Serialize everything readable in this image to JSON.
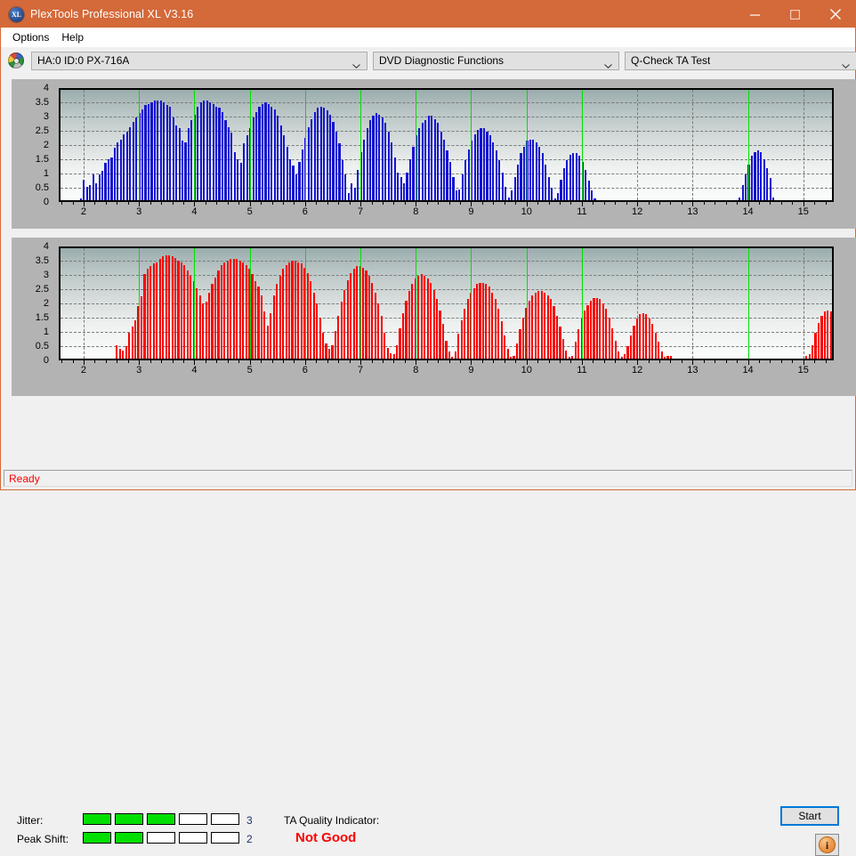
{
  "window": {
    "title": "PlexTools Professional XL V3.16",
    "app_icon": "XL",
    "minimize": "minimize-icon",
    "maximize": "maximize-icon",
    "close": "close-icon",
    "accent_color": "#d4693a"
  },
  "menu": {
    "items": [
      "Options",
      "Help"
    ]
  },
  "toolbar": {
    "drive_combo": {
      "value": "HA:0 ID:0  PX-716A",
      "icon": "disc-icon"
    },
    "function_combo": {
      "value": "DVD Diagnostic Functions"
    },
    "test_combo": {
      "value": "Q-Check TA Test"
    }
  },
  "indicators": {
    "jitter_label": "Jitter:",
    "jitter_value": "3",
    "jitter_segments": 5,
    "jitter_filled": 3,
    "peak_shift_label": "Peak Shift:",
    "peak_shift_value": "2",
    "peak_shift_segments": 5,
    "peak_shift_filled": 2,
    "meter_on_color": "#00e000",
    "ta_label": "TA Quality Indicator:",
    "ta_value": "Not Good",
    "ta_value_color": "#ff0000"
  },
  "actions": {
    "start_label": "Start",
    "info_label": "i",
    "info_name": "info-icon"
  },
  "statusbar": {
    "text": "Ready",
    "color": "#ff0000"
  },
  "chart_data": [
    {
      "id": "ta-test-chart-upper",
      "type": "bar",
      "title": "",
      "xlabel": "",
      "ylabel": "",
      "series_color": "#1414d2",
      "marker_color": "#00e000",
      "grid": true,
      "xlim": [
        1.55,
        15.55
      ],
      "ylim": [
        0,
        4
      ],
      "yticks": [
        0,
        0.5,
        1,
        1.5,
        2,
        2.5,
        3,
        3.5,
        4
      ],
      "ytick_labels": [
        "0",
        "0.5",
        "1",
        "1.5",
        "2",
        "2.5",
        "3",
        "3.5",
        "4"
      ],
      "xticks": [
        2,
        3,
        4,
        5,
        6,
        7,
        8,
        9,
        10,
        11,
        12,
        13,
        14,
        15
      ],
      "xtick_labels": [
        "2",
        "3",
        "4",
        "5",
        "6",
        "7",
        "8",
        "9",
        "10",
        "11",
        "12",
        "13",
        "14",
        "15"
      ],
      "markers_x": [
        3,
        4,
        5,
        6,
        7,
        8,
        9,
        10,
        11,
        14
      ],
      "bar_step": 0.0556,
      "x_start": 1.95,
      "values": [
        0.05,
        0.75,
        0.5,
        0.55,
        0.95,
        0.6,
        0.95,
        1.05,
        1.35,
        1.5,
        1.55,
        1.9,
        2.1,
        2.2,
        2.4,
        2.5,
        2.65,
        2.85,
        3.0,
        3.15,
        3.3,
        3.45,
        3.5,
        3.55,
        3.6,
        3.6,
        3.6,
        3.55,
        3.45,
        3.4,
        3.0,
        2.7,
        2.6,
        2.15,
        2.1,
        2.6,
        2.9,
        3.1,
        3.4,
        3.55,
        3.6,
        3.6,
        3.55,
        3.5,
        3.4,
        3.35,
        3.2,
        2.9,
        2.65,
        2.45,
        1.75,
        1.5,
        1.35,
        2.05,
        2.35,
        2.6,
        3.0,
        3.2,
        3.4,
        3.5,
        3.55,
        3.5,
        3.4,
        3.3,
        3.05,
        2.7,
        2.35,
        1.95,
        1.5,
        1.25,
        0.95,
        1.4,
        1.85,
        2.25,
        2.65,
        2.95,
        3.2,
        3.35,
        3.4,
        3.35,
        3.25,
        3.1,
        2.85,
        2.5,
        2.05,
        1.45,
        0.95,
        0.25,
        0.6,
        0.45,
        1.1,
        1.75,
        2.2,
        2.6,
        2.9,
        3.05,
        3.15,
        3.1,
        3.0,
        2.8,
        2.5,
        2.1,
        1.55,
        1.0,
        0.85,
        0.6,
        1.0,
        1.5,
        1.95,
        2.35,
        2.6,
        2.8,
        2.9,
        3.05,
        3.05,
        2.95,
        2.8,
        2.5,
        2.2,
        1.8,
        1.4,
        0.85,
        0.35,
        0.4,
        0.95,
        1.45,
        1.85,
        2.15,
        2.4,
        2.55,
        2.6,
        2.6,
        2.5,
        2.35,
        2.1,
        1.8,
        1.45,
        1.0,
        0.5,
        0.1,
        0.35,
        0.85,
        1.3,
        1.7,
        1.95,
        2.15,
        2.2,
        2.2,
        2.1,
        1.95,
        1.7,
        1.3,
        0.85,
        0.45,
        0.05,
        0.25,
        0.75,
        1.15,
        1.45,
        1.65,
        1.7,
        1.7,
        1.6,
        1.4,
        1.1,
        0.7,
        0.35,
        0.05,
        0,
        0,
        0,
        0,
        0,
        0,
        0,
        0,
        0,
        0,
        0,
        0,
        0,
        0,
        0,
        0,
        0,
        0,
        0,
        0,
        0,
        0,
        0,
        0,
        0,
        0,
        0,
        0,
        0,
        0,
        0,
        0,
        0,
        0,
        0,
        0,
        0,
        0,
        0,
        0,
        0,
        0,
        0,
        0,
        0,
        0,
        0.1,
        0.55,
        0.95,
        1.3,
        1.6,
        1.75,
        1.8,
        1.75,
        1.5,
        1.15,
        0.8,
        0.1,
        0,
        0,
        0,
        0,
        0,
        0,
        0,
        0,
        0,
        0,
        0,
        0,
        0,
        0,
        0,
        0,
        0,
        0,
        0
      ]
    },
    {
      "id": "ta-test-chart-lower",
      "type": "bar",
      "title": "",
      "xlabel": "",
      "ylabel": "",
      "series_color": "#fa0000",
      "marker_color": "#00e000",
      "grid": true,
      "xlim": [
        1.55,
        15.55
      ],
      "ylim": [
        0,
        4
      ],
      "yticks": [
        0,
        0.5,
        1,
        1.5,
        2,
        2.5,
        3,
        3.5,
        4
      ],
      "ytick_labels": [
        "0",
        "0.5",
        "1",
        "1.5",
        "2",
        "2.5",
        "3",
        "3.5",
        "4"
      ],
      "xticks": [
        2,
        3,
        4,
        5,
        6,
        7,
        8,
        9,
        10,
        11,
        12,
        13,
        14,
        15
      ],
      "xtick_labels": [
        "2",
        "3",
        "4",
        "5",
        "6",
        "7",
        "8",
        "9",
        "10",
        "11",
        "12",
        "13",
        "14",
        "15"
      ],
      "markers_x": [
        3,
        4,
        5,
        6,
        7,
        8,
        9,
        10,
        11,
        14
      ],
      "bar_step": 0.0556,
      "x_start": 2.6,
      "values": [
        0.5,
        0.35,
        0.3,
        0.45,
        0.95,
        1.15,
        1.4,
        1.9,
        2.25,
        3.05,
        3.25,
        3.35,
        3.45,
        3.5,
        3.6,
        3.7,
        3.75,
        3.75,
        3.7,
        3.65,
        3.55,
        3.5,
        3.4,
        3.2,
        3.0,
        2.8,
        2.55,
        2.3,
        2.0,
        2.05,
        2.4,
        2.7,
        2.95,
        3.2,
        3.4,
        3.5,
        3.55,
        3.6,
        3.6,
        3.6,
        3.55,
        3.5,
        3.4,
        3.25,
        3.05,
        2.8,
        2.6,
        2.3,
        1.7,
        1.2,
        1.65,
        2.3,
        2.7,
        3.0,
        3.25,
        3.4,
        3.5,
        3.55,
        3.55,
        3.5,
        3.45,
        3.3,
        3.1,
        2.8,
        2.4,
        2.0,
        1.5,
        0.95,
        0.55,
        0.35,
        0.5,
        1.0,
        1.55,
        2.05,
        2.5,
        2.85,
        3.1,
        3.25,
        3.35,
        3.35,
        3.3,
        3.2,
        3.0,
        2.75,
        2.4,
        2.0,
        1.55,
        0.95,
        0.4,
        0.2,
        0.15,
        0.5,
        1.1,
        1.65,
        2.1,
        2.45,
        2.7,
        2.9,
        3.0,
        3.05,
        3.0,
        2.9,
        2.75,
        2.5,
        2.15,
        1.75,
        1.25,
        0.65,
        0.25,
        0.05,
        0.25,
        0.9,
        1.4,
        1.8,
        2.15,
        2.4,
        2.55,
        2.7,
        2.75,
        2.75,
        2.7,
        2.6,
        2.4,
        2.15,
        1.8,
        1.35,
        0.85,
        0.35,
        0.05,
        0.1,
        0.55,
        1.05,
        1.5,
        1.85,
        2.1,
        2.3,
        2.4,
        2.45,
        2.45,
        2.4,
        2.3,
        2.15,
        1.9,
        1.55,
        1.15,
        0.7,
        0.3,
        0.05,
        0.1,
        0.6,
        1.05,
        1.45,
        1.75,
        1.95,
        2.1,
        2.2,
        2.2,
        2.15,
        2.0,
        1.8,
        1.5,
        1.1,
        0.65,
        0.25,
        0.05,
        0.15,
        0.45,
        0.85,
        1.2,
        1.45,
        1.6,
        1.65,
        1.6,
        1.45,
        1.25,
        0.95,
        0.6,
        0.25,
        0.05,
        0.1,
        0.1,
        0,
        0,
        0,
        0,
        0,
        0,
        0,
        0,
        0,
        0,
        0,
        0,
        0,
        0,
        0,
        0,
        0,
        0,
        0,
        0,
        0,
        0,
        0,
        0,
        0,
        0,
        0,
        0,
        0,
        0,
        0,
        0,
        0,
        0,
        0,
        0,
        0,
        0,
        0,
        0,
        0,
        0,
        0,
        0.1,
        0.15,
        0.5,
        0.95,
        1.3,
        1.55,
        1.7,
        1.75,
        1.7,
        1.55,
        1.25,
        0.9,
        0.45,
        0.1,
        0,
        0,
        0,
        0,
        0,
        0,
        0,
        0,
        0,
        0,
        0,
        0,
        0,
        0,
        0,
        0
      ]
    }
  ]
}
